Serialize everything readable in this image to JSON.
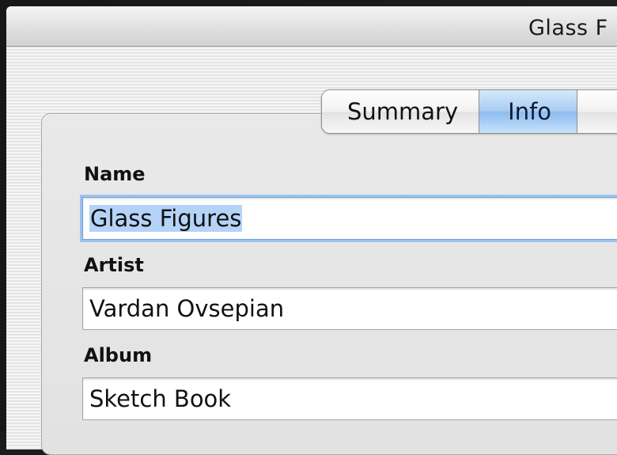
{
  "window": {
    "title": "Glass F"
  },
  "tabs": [
    {
      "label": "Summary",
      "active": false
    },
    {
      "label": "Info",
      "active": true
    },
    {
      "label": "",
      "active": false
    }
  ],
  "fields": {
    "name": {
      "label": "Name",
      "value": "Glass Figures"
    },
    "artist": {
      "label": "Artist",
      "value": "Vardan Ovsepian"
    },
    "album": {
      "label": "Album",
      "value": "Sketch Book"
    }
  },
  "colors": {
    "active_tab": "#a9cdf3",
    "focus_ring": "#9cc3ee",
    "selection": "#b5d3f7"
  }
}
